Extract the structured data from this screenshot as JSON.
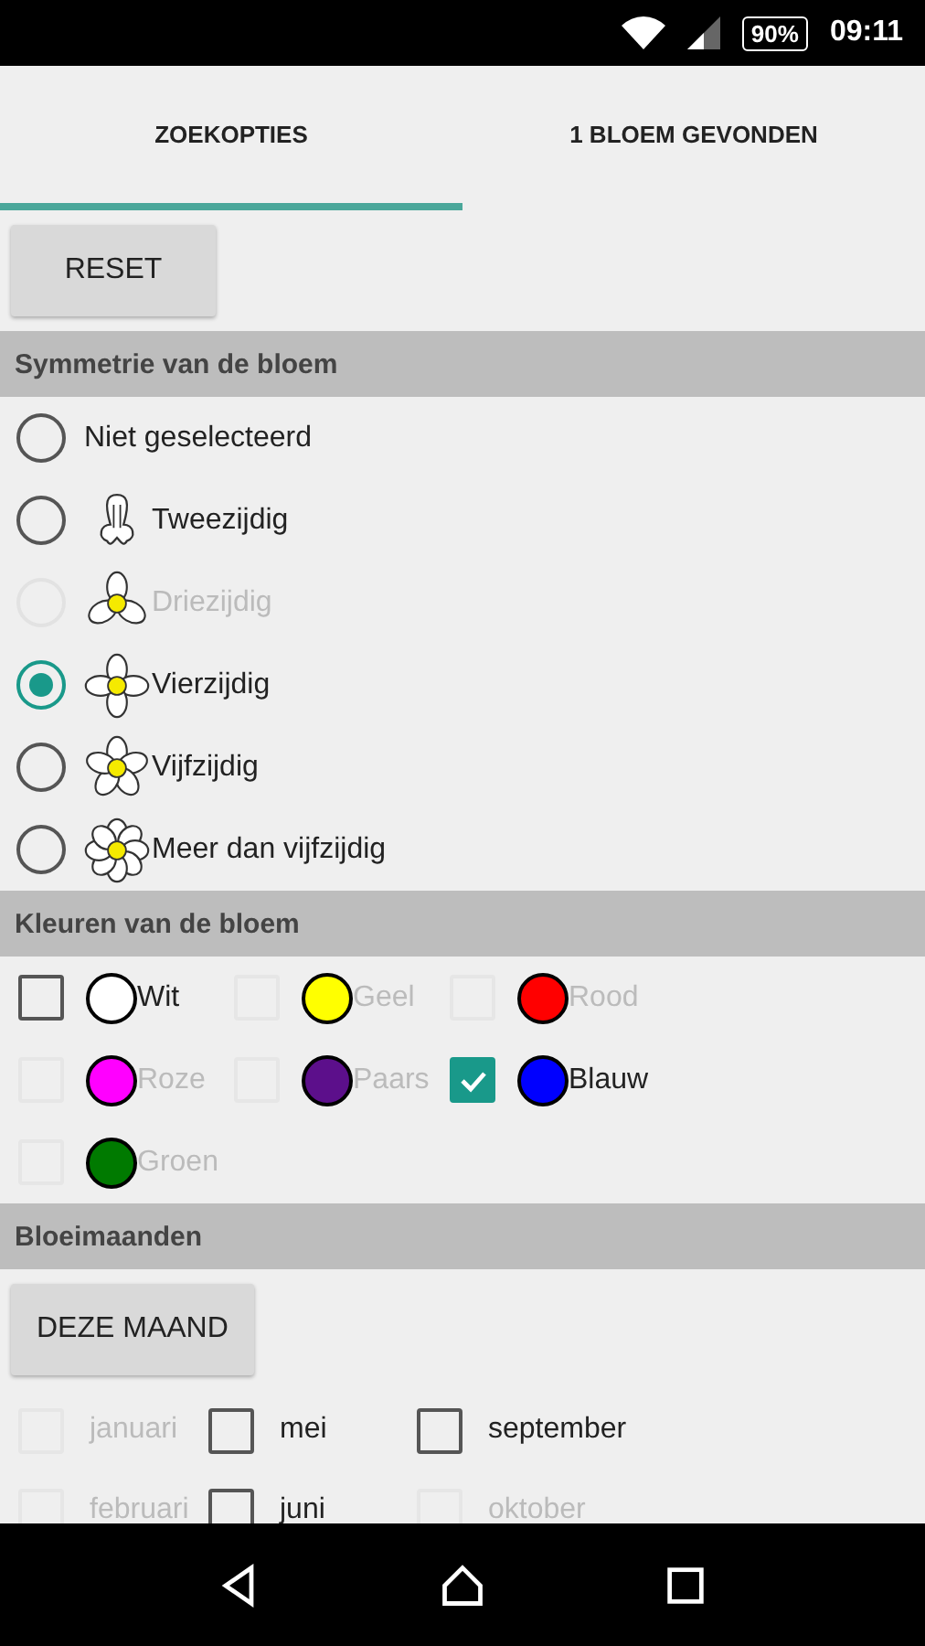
{
  "status_bar": {
    "battery": "90%",
    "time": "09:11"
  },
  "tabs": [
    {
      "label": "ZOEKOPTIES",
      "selected": true
    },
    {
      "label": "1 BLOEM GEVONDEN",
      "selected": false
    }
  ],
  "reset_button": "RESET",
  "symmetry": {
    "title": "Symmetrie van de bloem",
    "options": [
      {
        "label": "Niet geselecteerd",
        "kind": "none",
        "selected": false,
        "disabled": false
      },
      {
        "label": "Tweezijdig",
        "kind": "bilateral",
        "selected": false,
        "disabled": false
      },
      {
        "label": "Driezijdig",
        "kind": "three",
        "selected": false,
        "disabled": true
      },
      {
        "label": "Vierzijdig",
        "kind": "four",
        "selected": true,
        "disabled": false
      },
      {
        "label": "Vijfzijdig",
        "kind": "five",
        "selected": false,
        "disabled": false
      },
      {
        "label": "Meer dan vijfzijdig",
        "kind": "many",
        "selected": false,
        "disabled": false
      }
    ]
  },
  "colors": {
    "title": "Kleuren van de bloem",
    "items": [
      {
        "label": "Wit",
        "color": "#ffffff",
        "checked": false,
        "disabled": false
      },
      {
        "label": "Geel",
        "color": "#ffff00",
        "checked": false,
        "disabled": true
      },
      {
        "label": "Rood",
        "color": "#ff0000",
        "checked": false,
        "disabled": true
      },
      {
        "label": "Roze",
        "color": "#ff00ff",
        "checked": false,
        "disabled": true
      },
      {
        "label": "Paars",
        "color": "#5c0f8b",
        "checked": false,
        "disabled": true
      },
      {
        "label": "Blauw",
        "color": "#0000ff",
        "checked": true,
        "disabled": false
      },
      {
        "label": "Groen",
        "color": "#007a00",
        "checked": false,
        "disabled": true
      }
    ]
  },
  "months": {
    "title": "Bloeimaanden",
    "button": "DEZE MAAND",
    "items": [
      {
        "label": "januari",
        "checked": false,
        "disabled": true
      },
      {
        "label": "mei",
        "checked": false,
        "disabled": false
      },
      {
        "label": "september",
        "checked": false,
        "disabled": false
      },
      {
        "label": "februari",
        "checked": false,
        "disabled": true
      },
      {
        "label": "juni",
        "checked": false,
        "disabled": false
      },
      {
        "label": "oktober",
        "checked": false,
        "disabled": true
      }
    ]
  }
}
